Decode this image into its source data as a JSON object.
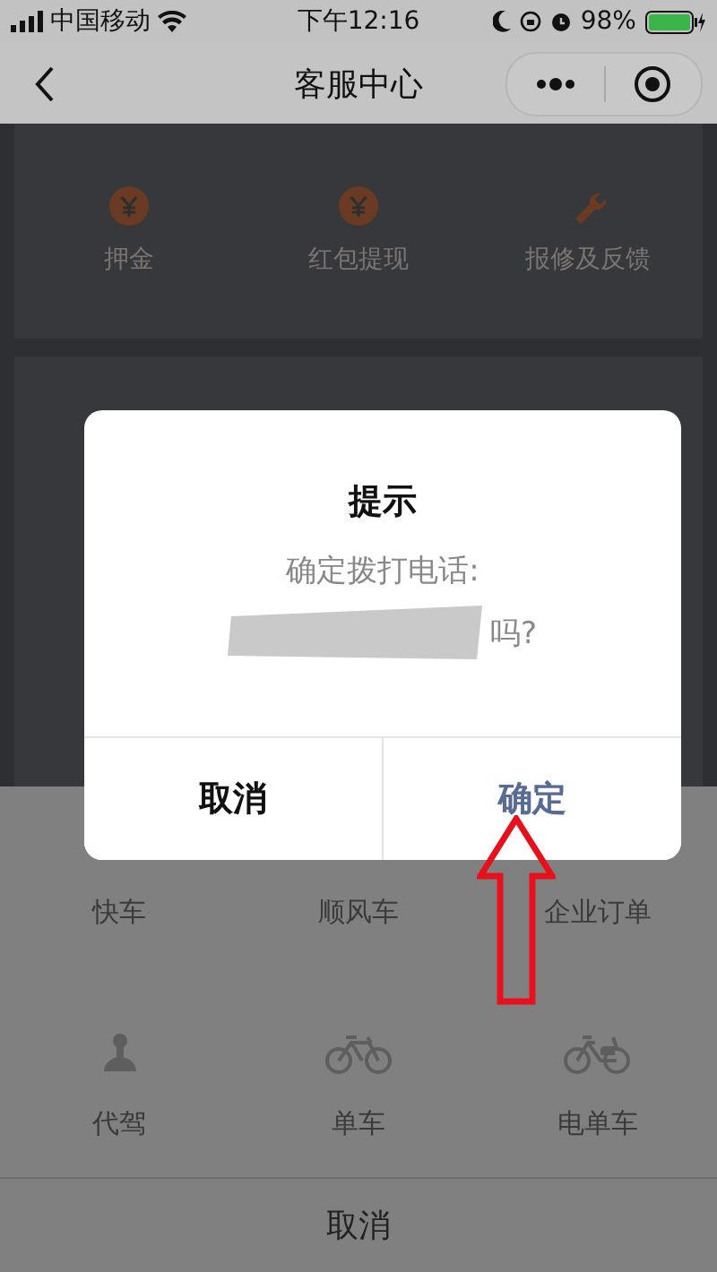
{
  "status_bar": {
    "carrier": "中国移动",
    "time": "下午12:16",
    "battery_text": "98%"
  },
  "nav": {
    "title": "客服中心"
  },
  "services": [
    {
      "label": "押金",
      "kind": "yen"
    },
    {
      "label": "红包提现",
      "kind": "yen"
    },
    {
      "label": "报修及反馈",
      "kind": "wrench"
    }
  ],
  "sheet_rows": [
    [
      {
        "label": "快车"
      },
      {
        "label": "顺风车"
      },
      {
        "label": "企业订单"
      }
    ],
    [
      {
        "label": "代驾",
        "kind": "driver"
      },
      {
        "label": "单车",
        "kind": "bike"
      },
      {
        "label": "电单车",
        "kind": "ebike"
      }
    ]
  ],
  "sheet_cancel": "取消",
  "dialog": {
    "title": "提示",
    "message": "确定拨打电话:",
    "message_end": "吗?",
    "buttons": [
      {
        "label": "取消",
        "kind": "cancel"
      },
      {
        "label": "确定",
        "kind": "confirm"
      }
    ]
  }
}
